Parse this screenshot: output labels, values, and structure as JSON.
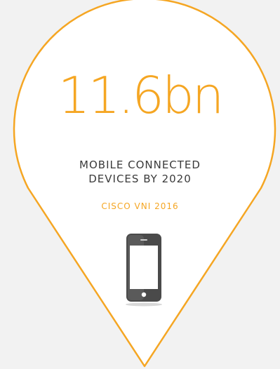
{
  "stat": {
    "value": "11.6bn",
    "label_line1": "MOBILE CONNECTED",
    "label_line2": "DEVICES BY 2020",
    "source": "CISCO VNI 2016"
  },
  "colors": {
    "accent": "#f5a623",
    "text": "#3a3a3a",
    "background": "#f2f2f2",
    "pin_fill": "#ffffff"
  },
  "icons": {
    "device": "smartphone-icon",
    "shape": "map-pin-shape"
  }
}
